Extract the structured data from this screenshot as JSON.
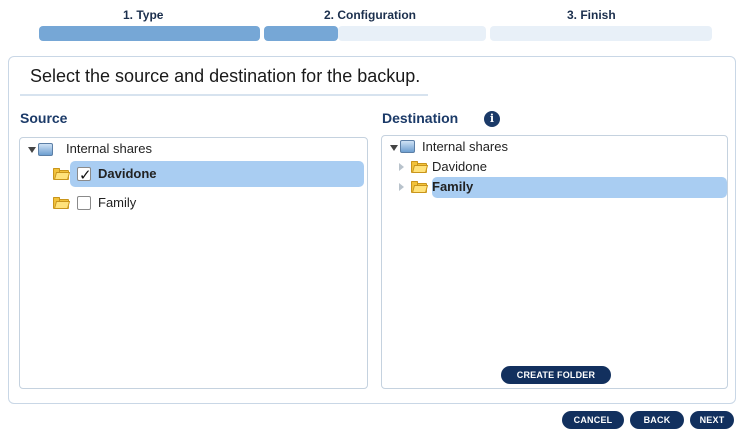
{
  "wizard": {
    "steps": [
      {
        "label": "1. Type"
      },
      {
        "label": "2. Configuration"
      },
      {
        "label": "3. Finish"
      }
    ]
  },
  "main": {
    "title": "Select the source and destination for the backup."
  },
  "source": {
    "label": "Source",
    "root": "Internal shares",
    "items": [
      {
        "label": "Davidone",
        "checked": true,
        "selected": true
      },
      {
        "label": "Family",
        "checked": false,
        "selected": false
      }
    ]
  },
  "destination": {
    "label": "Destination",
    "root": "Internal shares",
    "items": [
      {
        "label": "Davidone",
        "selected": false
      },
      {
        "label": "Family",
        "selected": true
      }
    ],
    "create_folder_label": "CREATE FOLDER"
  },
  "footer": {
    "cancel_label": "CANCEL",
    "back_label": "BACK",
    "next_label": "NEXT"
  },
  "colors": {
    "accent": "#12305e",
    "progress_done": "#76a7d6",
    "selection": "#a9cdf2"
  }
}
